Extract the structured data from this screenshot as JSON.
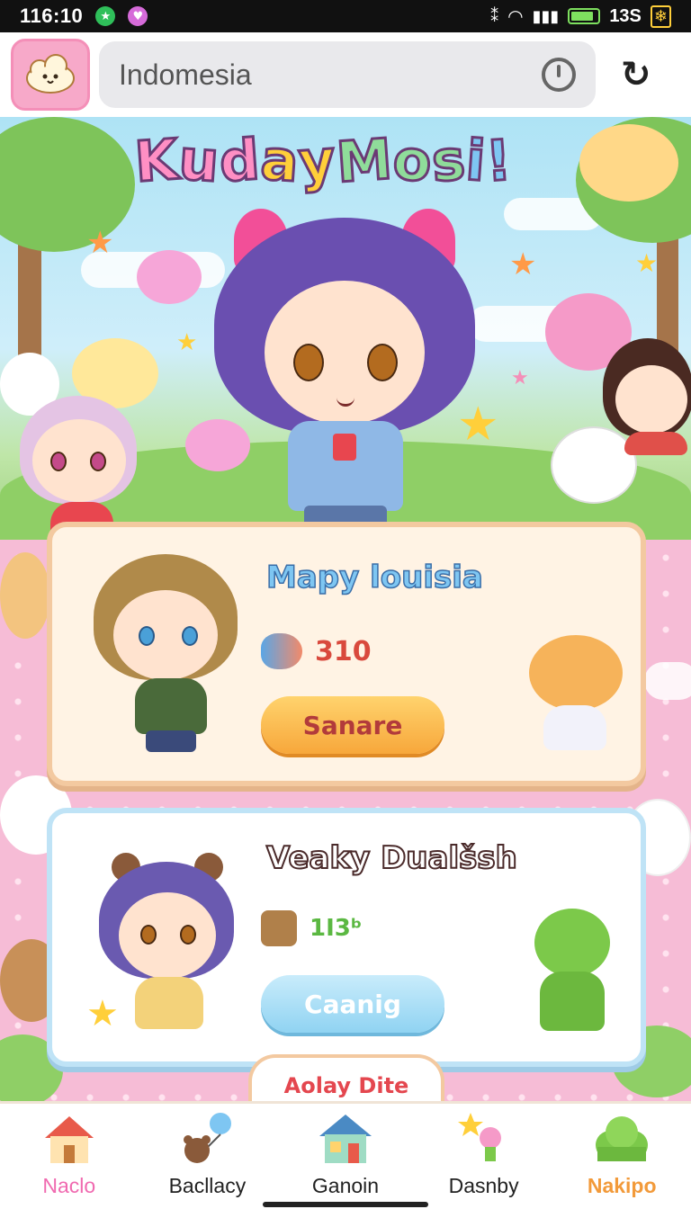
{
  "status_bar": {
    "time": "116:10",
    "battery_percent": "13S",
    "battery_level": 0.85,
    "battery_mark": "❄"
  },
  "top_bar": {
    "search_value": "Indomesia"
  },
  "hero": {
    "title": "Kuday Mosi!"
  },
  "cards": [
    {
      "title": "Mapy louisia",
      "stat_value": "310",
      "button_label": "Sanare"
    },
    {
      "title": "Veaky Dualšsh",
      "stat_value": "1I3ᵇ",
      "button_label": "Caanig"
    }
  ],
  "bottom_tab": {
    "label": "Aolay Dite"
  },
  "nav": {
    "items": [
      {
        "label": "Naclo",
        "icon": "house-icon"
      },
      {
        "label": "Bacllacy",
        "icon": "bear-balloon-icon"
      },
      {
        "label": "Ganoin",
        "icon": "shop-icon"
      },
      {
        "label": "Dasnby",
        "icon": "star-wand-icon"
      },
      {
        "label": "Nakipo",
        "icon": "bush-icon"
      }
    ]
  },
  "colors": {
    "accent_pink": "#f7a9c9",
    "title_gradient": [
      "#ff8fc4",
      "#ffcf3a",
      "#8fdc9a",
      "#7ec6f2"
    ]
  }
}
